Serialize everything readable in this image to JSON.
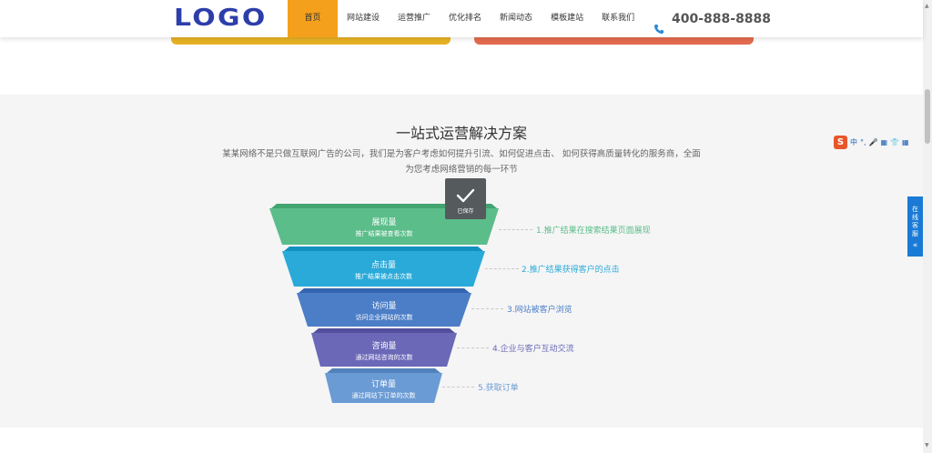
{
  "header": {
    "logo": "LOGO",
    "nav": [
      "首页",
      "网站建设",
      "运营推广",
      "优化排名",
      "新闻动态",
      "模板建站",
      "联系我们"
    ],
    "phone": "400-888-8888"
  },
  "section": {
    "title": "一站式运营解决方案",
    "description": "某某网络不是只做互联网广告的公司，我们是为客户考虑如何提升引流、如何促进点击、 如何获得高质量转化的服务商，全面为您考虑网络营销的每一环节"
  },
  "funnel": [
    {
      "name": "展现量",
      "sub": "推广结果被查看次数",
      "label": "1.推广结果在搜索结果页面展现",
      "color": "#5bbd8a",
      "label_color": "#5bbd8a"
    },
    {
      "name": "点击量",
      "sub": "推广结果被点击次数",
      "label": "2.推广结果获得客户的点击",
      "color": "#2aaad9",
      "label_color": "#2aaad9"
    },
    {
      "name": "访问量",
      "sub": "访问企业网站的次数",
      "label": "3.网站被客户浏览",
      "color": "#4c7ec7",
      "label_color": "#4c7ec7"
    },
    {
      "name": "咨询量",
      "sub": "通过网站咨询的次数",
      "label": "4.企业与客户互动交流",
      "color": "#6b68b8",
      "label_color": "#6b68b8"
    },
    {
      "name": "订单量",
      "sub": "通过网站下订单的次数",
      "label": "5.获取订单",
      "color": "#6a9bd4",
      "label_color": "#6a9bd4"
    }
  ],
  "toast": {
    "text": "已保存",
    "icon": "check-icon"
  },
  "float_service": {
    "label": "在线客服",
    "arrow": "«"
  },
  "ime": {
    "items": [
      "中",
      "°,",
      "🎤",
      "▦",
      "👕",
      "▦"
    ]
  },
  "colors": {
    "accent": "#f5a01c",
    "logo": "#2d3eaa",
    "service": "#1a7bd6"
  }
}
